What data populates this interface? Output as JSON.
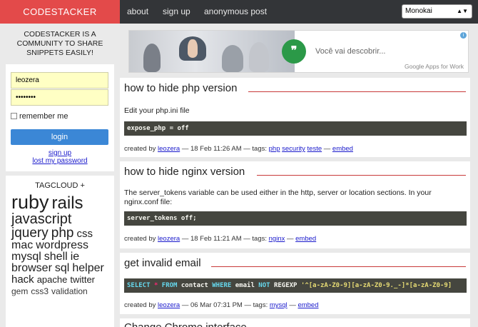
{
  "header": {
    "brand": "CODESTACKER",
    "nav": [
      "about",
      "sign up",
      "anonymous post"
    ],
    "theme_select": "Monokai"
  },
  "sidebar": {
    "tagline": "CODESTACKER IS A COMMUNITY TO SHARE SNIPPETS EASILY!",
    "login": {
      "username_value": "leozera",
      "password_value": "••••••••",
      "remember_label": "remember me",
      "login_button": "login",
      "signup_link": "sign up",
      "lost_password_link": "lost my password"
    },
    "tagcloud": {
      "title": "TAGCLOUD +",
      "tags": [
        "ruby",
        "rails",
        "javascript",
        "jquery",
        "php",
        "css",
        "mac",
        "wordpress",
        "mysql",
        "shell",
        "ie",
        "browser",
        "sql",
        "helper",
        "hack",
        "apache",
        "twitter",
        "gem",
        "css3",
        "validation"
      ]
    }
  },
  "ad": {
    "text": "Você vai descobrir...",
    "brand": "Google Apps for Work",
    "badge": "i",
    "colors": {
      "logo_green": "#2b9948"
    }
  },
  "posts": [
    {
      "title": "how to hide php version",
      "description": "Edit your php.ini file",
      "code": "expose_php = off",
      "meta": {
        "created_by": "created by",
        "author": "leozera",
        "date": "— 18 Feb 11:26 AM — tags:",
        "tags": [
          "php",
          "security",
          "teste"
        ],
        "sep": "—",
        "embed": "embed"
      }
    },
    {
      "title": "how to hide nginx version",
      "description": "The server_tokens variable can be used either in the http, server or location sections. In your nginx.conf file:",
      "code": "server_tokens off;",
      "meta": {
        "created_by": "created by",
        "author": "leozera",
        "date": "— 18 Feb 11:21 AM — tags:",
        "tags": [
          "nginx"
        ],
        "sep": "—",
        "embed": "embed"
      }
    },
    {
      "title": "get invalid email",
      "code_tokens": [
        "SELECT",
        "*",
        "FROM",
        "contact",
        "WHERE",
        "email",
        "NOT",
        "REGEXP",
        "'^[a-zA-Z0-9][a-zA-Z0-9._-]*[a-zA-Z0-9]"
      ],
      "meta": {
        "created_by": "created by",
        "author": "leozera",
        "date": "— 06 Mar 07:31 PM — tags:",
        "tags": [
          "mysql"
        ],
        "sep": "—",
        "embed": "embed"
      }
    },
    {
      "title": "Change Chrome interface"
    }
  ],
  "colors": {
    "brand_red": "#e34a4a",
    "topbar": "#333538",
    "title_rule": "#c83a3a",
    "login_button": "#3b87d6",
    "code_bg": "#45463f"
  }
}
